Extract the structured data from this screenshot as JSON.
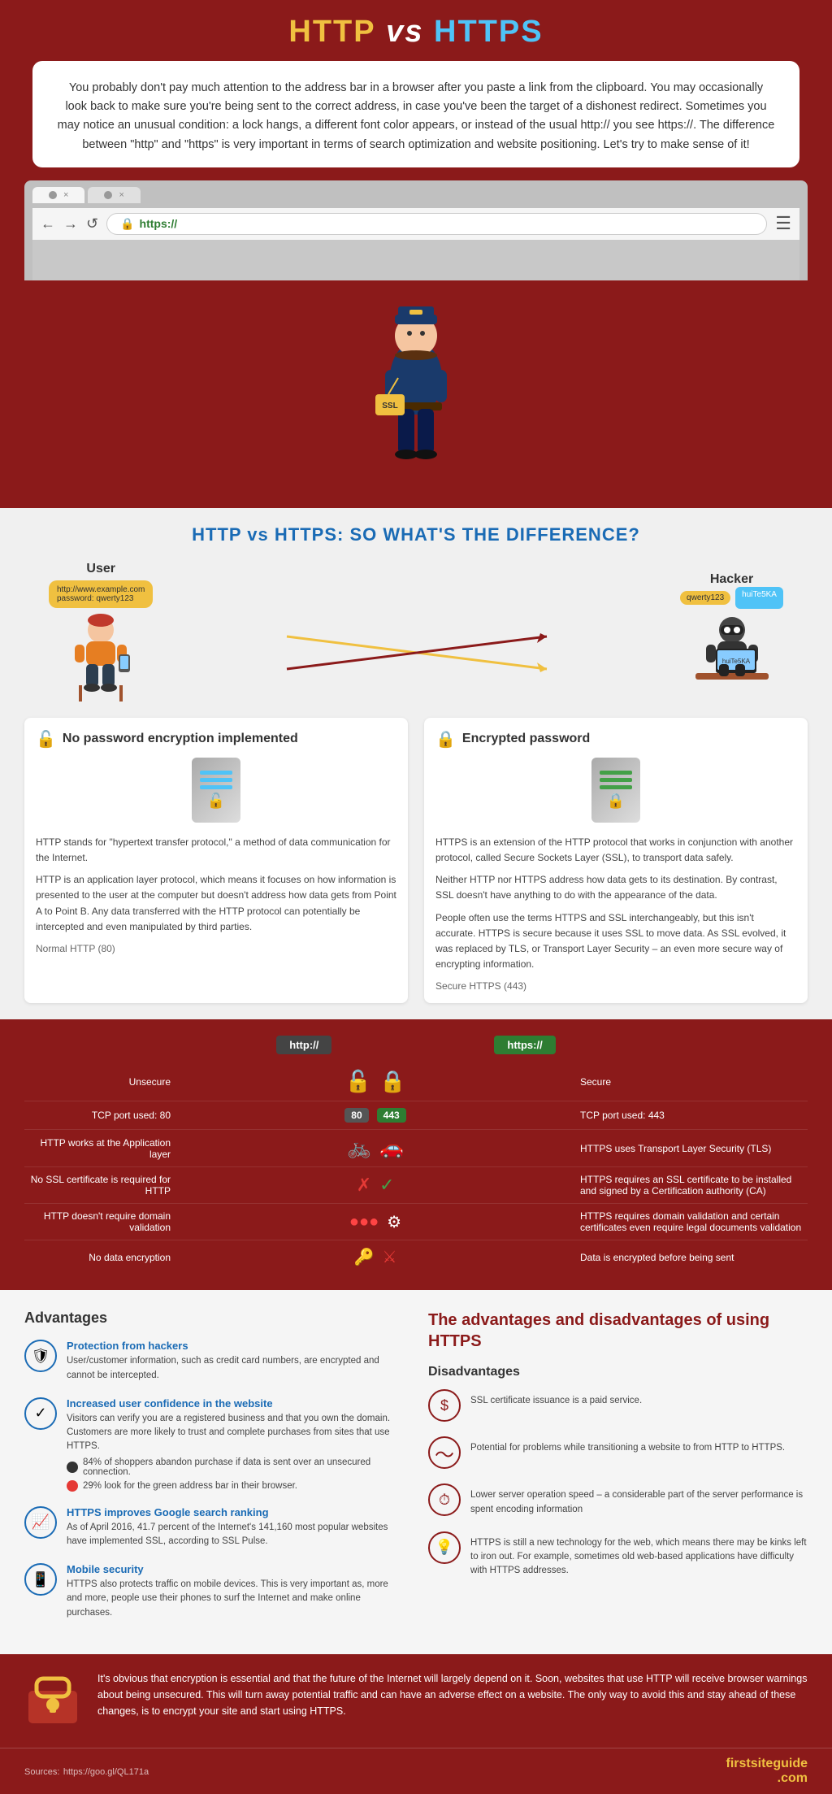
{
  "header": {
    "title_http": "HTTP",
    "title_vs": " vs ",
    "title_https": "HTTPS"
  },
  "intro": {
    "text": "You probably don't pay much attention to the address bar in a browser after you paste a link from the clipboard. You may occasionally look back to make sure you're being sent to the correct address, in case you've been the target of a dishonest redirect. Sometimes you may notice an unusual condition: a lock hangs, a different font color appears, or instead of the usual http:// you see https://. The difference between \"http\" and \"https\" is very important in terms of search optimization and website positioning. Let's try to make sense of it!"
  },
  "browser": {
    "url_protocol": "https://",
    "nav_back": "←",
    "nav_forward": "→",
    "nav_refresh": "↺"
  },
  "diff_section": {
    "title": "HTTP vs HTTPS: SO WHAT'S THE DIFFERENCE?",
    "user_label": "User",
    "hacker_label": "Hacker",
    "user_data": "http://www.example.com\npassword: qwerty123",
    "hacker_data": "qwerty123",
    "hacker_screen": "huiTe5KA"
  },
  "http_card": {
    "title": "No password encryption implemented",
    "subtitle": "Normal HTTP (80)",
    "text1": "HTTP stands for \"hypertext transfer protocol,\" a method of data communication for the Internet.",
    "text2": "HTTP is an application layer protocol, which means it focuses on how information is presented to the user at the computer but doesn't address how data gets from Point A to Point B. Any data transferred with the HTTP protocol can potentially be intercepted and even manipulated by third parties."
  },
  "https_card": {
    "title": "Encrypted password",
    "subtitle": "Secure HTTPS (443)",
    "text1": "HTTPS is an extension of the HTTP protocol that works in conjunction with another protocol, called Secure Sockets Layer (SSL), to transport data safely.",
    "text2": "Neither HTTP nor HTTPS address how data gets to its destination. By contrast, SSL doesn't have anything to do with the appearance of the data.",
    "text3": "People often use the terms HTTPS and SSL interchangeably, but this isn't accurate. HTTPS is secure because it uses SSL to move data. As SSL evolved, it was replaced by TLS, or Transport Layer Security – an even more secure way of encrypting information."
  },
  "comparison": {
    "http_header": "http://",
    "https_header": "https://",
    "rows": [
      {
        "left_label": "Unsecure",
        "left_icon": "🔓",
        "center_icon": "",
        "right_icon": "🔒",
        "right_label": "Secure"
      },
      {
        "left_label": "TCP port used: 80",
        "left_icon": "",
        "port_left": "80",
        "port_right": "443",
        "right_label": "TCP port used: 443"
      },
      {
        "left_label": "HTTP works at the Application layer",
        "left_icon": "🚲",
        "right_icon": "🚗",
        "right_label": "HTTPS uses Transport Layer Security (TLS)"
      },
      {
        "left_label": "No SSL certificate is required for HTTP",
        "left_icon": "✗",
        "right_icon": "✓",
        "right_label": "HTTPS requires an SSL certificate to be installed and signed by a Certification authority (CA)"
      },
      {
        "left_label": "HTTP doesn't require domain validation",
        "left_icon": "🔴",
        "right_icon": "⚙",
        "right_label": "HTTPS requires domain validation and certain certificates even require legal documents validation"
      },
      {
        "left_label": "No data encryption",
        "left_icon": "🔑",
        "right_icon": "⚔",
        "right_label": "Data is encrypted before being sent"
      }
    ]
  },
  "advantages": {
    "section_title": "Advantages",
    "right_title": "The advantages and disadvantages of using HTTPS",
    "adv_subtitle": "Disadvantages",
    "items": [
      {
        "icon": "🛡",
        "title": "Protection from hackers",
        "text": "User/customer information, such as credit card numbers, are encrypted and cannot be intercepted."
      },
      {
        "icon": "✓",
        "title": "Increased user confidence in the website",
        "text": "Visitors can verify you are a registered business and that you own the domain. Customers are more likely to trust and complete purchases from sites that use HTTPS.",
        "stat1": "84% of shoppers abandon purchase if data is sent over an unsecured connection.",
        "stat2": "29% look for the green address bar in their browser."
      },
      {
        "icon": "📈",
        "title": "HTTPS improves Google search ranking",
        "text": "As of April 2016, 41.7 percent of the Internet's 141,160 most popular websites have implemented SSL, according to SSL Pulse."
      },
      {
        "icon": "📱",
        "title": "Mobile security",
        "text": "HTTPS also protects traffic on mobile devices. This is very important as, more and more, people use their phones to surf the Internet and make online purchases."
      }
    ],
    "disadvantages": [
      {
        "icon": "$",
        "text": "SSL certificate issuance is a paid service."
      },
      {
        "icon": "〜",
        "text": "Potential for problems while transitioning a website to from HTTP to HTTPS."
      },
      {
        "icon": "⏱",
        "text": "Lower server operation speed – a considerable part of the server performance is spent encoding information"
      },
      {
        "icon": "💡",
        "text": "HTTPS is still a new technology for the web, which means there may be kinks left to iron out. For example, sometimes old web-based applications have difficulty with HTTPS addresses."
      }
    ]
  },
  "conclusion": {
    "text": "It's obvious that encryption is essential and that the future of the Internet will largely depend on it. Soon, websites that use HTTP will receive browser warnings about being unsecured. This will turn away potential traffic and can have an adverse effect on a website. The only way to avoid this and stay ahead of these changes, is to encrypt your site and start using HTTPS."
  },
  "footer": {
    "source_label": "Sources:",
    "source_url": "https://goo.gl/QL171a",
    "brand_first": "first",
    "brand_site": "site",
    "brand_guide": "guide",
    "brand_com": ".com"
  }
}
